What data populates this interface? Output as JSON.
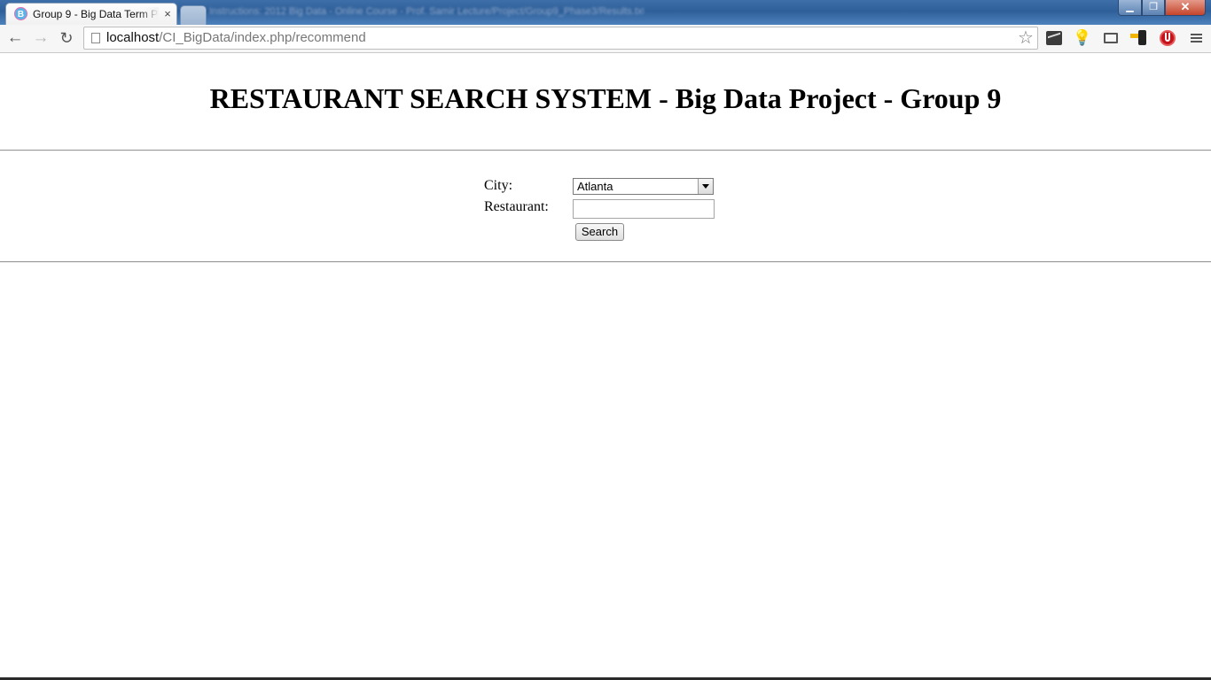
{
  "browser": {
    "tab_active_title": "Group 9 - Big Data Term P",
    "tab_active_favicon": "B",
    "tab_close": "×",
    "titlebar_background_text": "Instructions: 2012 Big Data - Online Course - Prof. Samir Lecture/Project/Group9_Phase3/Results.txt",
    "url_host": "localhost",
    "url_path": "/CI_BigData/index.php/recommend",
    "icons": [
      "back-arrow-icon",
      "forward-arrow-icon",
      "reload-icon",
      "page-icon",
      "star-icon",
      "chart-extension-icon",
      "lightbulb-extension-icon",
      "cast-icon",
      "phone-extension-icon",
      "stop-extension-icon",
      "menu-icon"
    ],
    "window_buttons": {
      "minimize": "▁",
      "maximize": "❐",
      "close": "✕"
    }
  },
  "page": {
    "title": "RESTAURANT SEARCH SYSTEM - Big Data Project - Group 9",
    "form": {
      "city_label": "City:",
      "city_selected": "Atlanta",
      "restaurant_label": "Restaurant:",
      "restaurant_value": "",
      "search_button": "Search"
    }
  },
  "colors": {
    "titlebar": "#3f6fa8",
    "rule": "#9a9a9a",
    "text": "#000000"
  }
}
